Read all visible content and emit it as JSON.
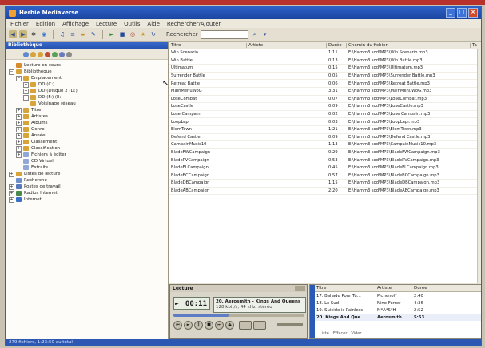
{
  "app": {
    "title": "Herbie Mediaverse"
  },
  "menu": [
    "Fichier",
    "Edition",
    "Affichage",
    "Lecture",
    "Outils",
    "Aide",
    "Rechercher/Ajouter"
  ],
  "toolbar": {
    "search_label": "Rechercher",
    "search_value": ""
  },
  "sidebar": {
    "header": "Bibliothèque",
    "tree": [
      {
        "label": "Lecture en cours",
        "level": 0,
        "expander": "",
        "icon_color": "#d98a2a"
      },
      {
        "label": "Bibliothèque",
        "level": 0,
        "expander": "−",
        "icon_color": "#d7a43a"
      },
      {
        "label": "Emplacement",
        "level": 1,
        "expander": "−",
        "icon_color": "#d7a43a"
      },
      {
        "label": "DD (C:)",
        "level": 2,
        "expander": "+",
        "icon_color": "#d7a43a"
      },
      {
        "label": "DD (Disque 2 (D:)",
        "level": 2,
        "expander": "+",
        "icon_color": "#d7a43a"
      },
      {
        "label": "DD (F:) (E:)",
        "level": 2,
        "expander": "+",
        "icon_color": "#d7a43a"
      },
      {
        "label": "Voisinage réseau",
        "level": 2,
        "expander": "",
        "icon_color": "#d7a43a"
      },
      {
        "label": "Titre",
        "level": 1,
        "expander": "+",
        "icon_color": "#d7a43a"
      },
      {
        "label": "Artistes",
        "level": 1,
        "expander": "+",
        "icon_color": "#d7a43a"
      },
      {
        "label": "Albums",
        "level": 1,
        "expander": "+",
        "icon_color": "#d7a43a"
      },
      {
        "label": "Genre",
        "level": 1,
        "expander": "+",
        "icon_color": "#d7a43a"
      },
      {
        "label": "Année",
        "level": 1,
        "expander": "+",
        "icon_color": "#d7a43a"
      },
      {
        "label": "Classement",
        "level": 1,
        "expander": "+",
        "icon_color": "#d7a43a"
      },
      {
        "label": "Classification",
        "level": 1,
        "expander": "+",
        "icon_color": "#d7a43a"
      },
      {
        "label": "Fichiers à éditer",
        "level": 1,
        "expander": "+",
        "icon_color": "#8fa8d8"
      },
      {
        "label": "CD Virtuel",
        "level": 1,
        "expander": "",
        "icon_color": "#8fa8d8"
      },
      {
        "label": "Extraits",
        "level": 1,
        "expander": "",
        "icon_color": "#8fa8d8"
      },
      {
        "label": "Listes de lecture",
        "level": 0,
        "expander": "+",
        "icon_color": "#d7a43a"
      },
      {
        "label": "Recherche",
        "level": 0,
        "expander": "",
        "icon_color": "#6f8fcf"
      },
      {
        "label": "Postes de travail",
        "level": 0,
        "expander": "+",
        "icon_color": "#5a7ac0"
      },
      {
        "label": "Radios Internet",
        "level": 0,
        "expander": "+",
        "icon_color": "#4a8a4a"
      },
      {
        "label": "Internet",
        "level": 0,
        "expander": "+",
        "icon_color": "#3a70c8"
      }
    ]
  },
  "tracklist": {
    "columns": [
      "Titre",
      "Artiste",
      "Durée",
      "Chemin du fichier",
      "Ta"
    ],
    "rows": [
      [
        "Win Scenario",
        "",
        "1:11",
        "E:\\Hamm3 sod\\MP3\\Win Scenario.mp3",
        ""
      ],
      [
        "Win Battle",
        "",
        "0:13",
        "E:\\Hamm3 sod\\MP3\\Win Battle.mp3",
        ""
      ],
      [
        "Ultimatum",
        "",
        "0:15",
        "E:\\Hamm3 sod\\MP3\\Ultimatum.mp3",
        ""
      ],
      [
        "Surrender Battle",
        "",
        "0:05",
        "E:\\Hamm3 sod\\MP3\\Surrender Battle.mp3",
        ""
      ],
      [
        "Retreat Battle",
        "",
        "0:06",
        "E:\\Hamm3 sod\\MP3\\Retreat Battle.mp3",
        ""
      ],
      [
        "MainMenuWoG",
        "",
        "3:31",
        "E:\\Hamm3 sod\\MP3\\MainMenuWoG.mp3",
        ""
      ],
      [
        "LoseCombat",
        "",
        "0:07",
        "E:\\Hamm3 sod\\MP3\\LoseCombat.mp3",
        ""
      ],
      [
        "LoseCastle",
        "",
        "0:09",
        "E:\\Hamm3 sod\\MP3\\LoseCastle.mp3",
        ""
      ],
      [
        "Lose Campain",
        "",
        "0:02",
        "E:\\Hamm3 sod\\MP3\\Lose Campain.mp3",
        ""
      ],
      [
        "LoopLepr",
        "",
        "0:03",
        "E:\\Hamm3 sod\\MP3\\LoopLepr.mp3",
        ""
      ],
      [
        "ElemTown",
        "",
        "1:21",
        "E:\\Hamm3 sod\\MP3\\ElemTown.mp3",
        ""
      ],
      [
        "Defend Castle",
        "",
        "0:09",
        "E:\\Hamm3 sod\\MP3\\Defend Castle.mp3",
        ""
      ],
      [
        "CampainMusic10",
        "",
        "1:13",
        "E:\\Hamm3 sod\\MP3\\CampainMusic10.mp3",
        ""
      ],
      [
        "BladeFWCampaign",
        "",
        "0:29",
        "E:\\Hamm3 sod\\MP3\\BladeFWCampaign.mp3",
        ""
      ],
      [
        "BladePVCampaign",
        "",
        "0:53",
        "E:\\Hamm3 sod\\MP3\\BladePVCampaign.mp3",
        ""
      ],
      [
        "BladeFLCampaign",
        "",
        "0:45",
        "E:\\Hamm3 sod\\MP3\\BladeFLCampaign.mp3",
        ""
      ],
      [
        "BladeBCCampaign",
        "",
        "0:57",
        "E:\\Hamm3 sod\\MP3\\BladeBCCampaign.mp3",
        ""
      ],
      [
        "BladeDBCampaign",
        "",
        "1:15",
        "E:\\Hamm3 sod\\MP3\\BladeDBCampaign.mp3",
        ""
      ],
      [
        "BladeABCampaign",
        "",
        "2:20",
        "E:\\Hamm3 sod\\MP3\\BladeABCampaign.mp3",
        ""
      ]
    ]
  },
  "player": {
    "title": "Lecture",
    "time": "00:11",
    "now_playing": "20. Aerosmith - Kings And Queens",
    "now_playing_sub": "128 kbit/s, 44 kHz, stéréo",
    "progress": 0.42
  },
  "queue": {
    "columns": [
      "Titre",
      "Artiste",
      "Durée"
    ],
    "rows": [
      [
        "17. Ballade Pour Tu...",
        "Pichenoff",
        "2:40"
      ],
      [
        "18. Le Sud",
        "Nino Ferrer",
        "4:36"
      ],
      [
        "19. Suicide is Painless",
        "M*A*S*H",
        "2:52"
      ],
      [
        "20. Kings And Que...",
        "Aerosmith",
        "5:53"
      ]
    ],
    "current_index": 3,
    "footer": [
      "Liste",
      "Effacer",
      "Vider"
    ]
  },
  "status": {
    "text": "279 fichiers, 1:23:50 au total"
  }
}
